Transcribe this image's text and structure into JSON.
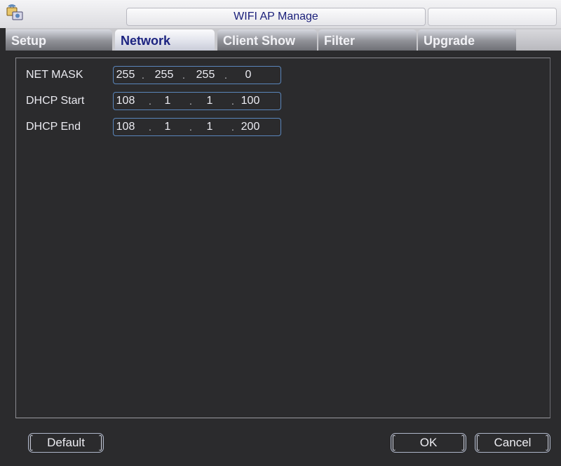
{
  "window": {
    "title": "WIFI AP Manage",
    "icon": "wifi-ap-app-icon"
  },
  "tabs": [
    {
      "label": "Setup",
      "active": false
    },
    {
      "label": "Network",
      "active": true
    },
    {
      "label": "Client Show",
      "active": false
    },
    {
      "label": "Filter",
      "active": false
    },
    {
      "label": "Upgrade",
      "active": false
    }
  ],
  "fields": {
    "net_mask": {
      "label": "NET MASK",
      "octets": [
        "255",
        "255",
        "255",
        "0"
      ]
    },
    "dhcp_start": {
      "label": "DHCP Start",
      "octets": [
        "108",
        "1",
        "1",
        "100"
      ]
    },
    "dhcp_end": {
      "label": "DHCP End",
      "octets": [
        "108",
        "1",
        "1",
        "200"
      ]
    }
  },
  "ip_separator": ".",
  "buttons": {
    "default": "Default",
    "ok": "OK",
    "cancel": "Cancel"
  },
  "colors": {
    "background": "#2b2b2d",
    "title_text": "#1a1f7a",
    "field_border": "#5a86bb",
    "active_tab_text": "#1c2380"
  }
}
